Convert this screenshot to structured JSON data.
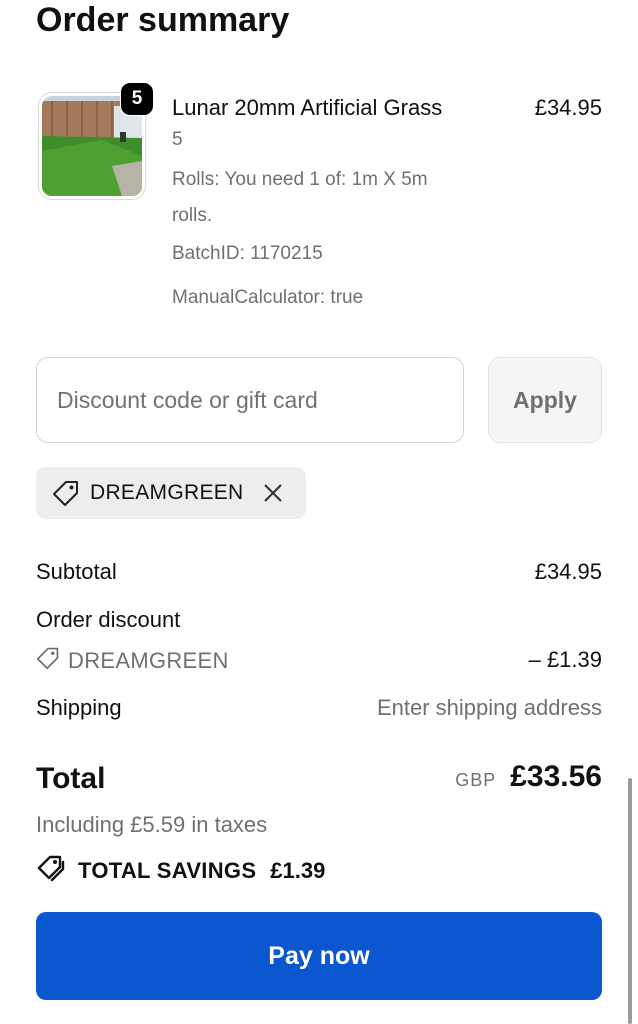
{
  "header": {
    "title": "Order summary"
  },
  "line_item": {
    "quantity_badge": "5",
    "name": "Lunar 20mm Artificial Grass",
    "price": "£34.95",
    "quantity_text": "5",
    "rolls": "Rolls: You need 1 of: 1m X 5m rolls.",
    "batch": "BatchID: 1170215",
    "manual": "ManualCalculator: true",
    "image_icon": "artificial-grass-photo"
  },
  "discount": {
    "placeholder": "Discount code or gift card",
    "value": "",
    "apply_label": "Apply",
    "applied_code": "DREAMGREEN"
  },
  "totals": {
    "subtotal_label": "Subtotal",
    "subtotal_value": "£34.95",
    "order_discount_label": "Order discount",
    "discount_code": "DREAMGREEN",
    "discount_value": "– £1.39",
    "shipping_label": "Shipping",
    "shipping_value": "Enter shipping address",
    "total_label": "Total",
    "currency": "GBP",
    "total_value": "£33.56",
    "taxes_text": "Including £5.59 in taxes",
    "savings_label": "TOTAL SAVINGS",
    "savings_value": "£1.39"
  },
  "actions": {
    "pay_label": "Pay now"
  },
  "colors": {
    "primary": "#0b57d0",
    "muted": "#707070",
    "chip_bg": "#ededed"
  }
}
